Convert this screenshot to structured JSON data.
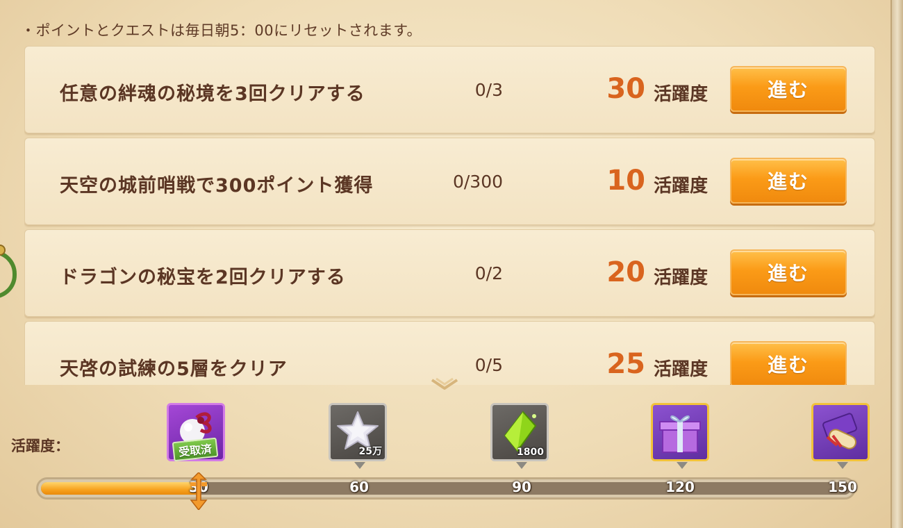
{
  "notice": "・ポイントとクエストは毎日朝5：00にリセットされます。",
  "quests": [
    {
      "name": "任意の絆魂の秘境を3回クリアする",
      "progress": "0/3",
      "points": "30",
      "unit": "活躍度",
      "button": "進む"
    },
    {
      "name": "天空の城前哨戦で300ポイント獲得",
      "progress": "0/300",
      "points": "10",
      "unit": "活躍度",
      "button": "進む"
    },
    {
      "name": "ドラゴンの秘宝を2回クリアする",
      "progress": "0/2",
      "points": "20",
      "unit": "活躍度",
      "button": "進む"
    },
    {
      "name": "天啓の試練の5層をクリア",
      "progress": "0/5",
      "points": "25",
      "unit": "活躍度",
      "button": "進む"
    }
  ],
  "activity": {
    "label": "活躍度：",
    "current": 30,
    "max": 150,
    "ticks": [
      "30",
      "60",
      "90",
      "120",
      "150"
    ],
    "rewards": [
      {
        "icon": "orb-bundle-icon",
        "status": "受取済",
        "qty": ""
      },
      {
        "icon": "silver-star-icon",
        "status": "",
        "qty": "25万"
      },
      {
        "icon": "green-crystal-icon",
        "status": "",
        "qty": "1800"
      },
      {
        "icon": "gift-box-icon",
        "status": "",
        "qty": ""
      },
      {
        "icon": "scroll-bundle-icon",
        "status": "",
        "qty": ""
      }
    ]
  },
  "colors": {
    "accent": "#f08a0e",
    "points": "#d9641e",
    "text": "#5b3624",
    "claimed": "#4e9628"
  }
}
